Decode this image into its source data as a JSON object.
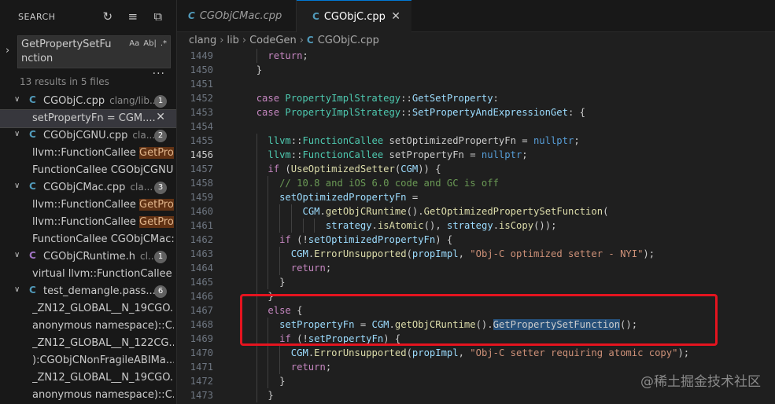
{
  "sidebar": {
    "title": "SEARCH",
    "search_value": "GetPropertySetFunction",
    "opt_case": "Aa",
    "opt_word": "Ab|",
    "opt_regex": ".*",
    "results": "13 results in 5 files",
    "more": "···",
    "files": [
      {
        "name": "CGObjC.cpp",
        "path": "clang/lib...",
        "count": "1",
        "kind": "cpp",
        "matches": [
          {
            "pre": "setPropertyFn = CGM....",
            "hl": "",
            "active": true
          }
        ]
      },
      {
        "name": "CGObjCGNU.cpp",
        "path": "cla...",
        "count": "2",
        "kind": "cpp",
        "matches": [
          {
            "pre": "llvm::FunctionCallee ",
            "hl": "GetPro..."
          },
          {
            "pre": "FunctionCallee CGObjCGNU...",
            "hl": ""
          }
        ]
      },
      {
        "name": "CGObjCMac.cpp",
        "path": "cla...",
        "count": "3",
        "kind": "cpp",
        "matches": [
          {
            "pre": "llvm::FunctionCallee ",
            "hl": "GetPro..."
          },
          {
            "pre": "llvm::FunctionCallee ",
            "hl": "GetPro..."
          },
          {
            "pre": "FunctionCallee CGObjCMac:...",
            "hl": ""
          }
        ]
      },
      {
        "name": "CGObjCRuntime.h",
        "path": "cl...",
        "count": "1",
        "kind": "h",
        "matches": [
          {
            "pre": "virtual llvm::FunctionCallee ",
            "hl": "..."
          }
        ]
      },
      {
        "name": "test_demangle.pass....",
        "path": "",
        "count": "6",
        "kind": "cpp",
        "matches": [
          {
            "pre": "_ZN12_GLOBAL__N_19CGO...",
            "hl": ""
          },
          {
            "pre": "anonymous namespace)::C...",
            "hl": ""
          },
          {
            "pre": "_ZN12_GLOBAL__N_122CG...",
            "hl": ""
          },
          {
            "pre": "):CGObjCNonFragileABIMa...",
            "hl": ""
          },
          {
            "pre": "_ZN12_GLOBAL__N_19CGO...",
            "hl": ""
          },
          {
            "pre": "anonymous namespace)::C...",
            "hl": ""
          }
        ]
      }
    ]
  },
  "tabs": [
    {
      "label": "CGObjCMac.cpp",
      "icon": "C"
    },
    {
      "label": "CGObjC.cpp",
      "icon": "C",
      "close": "✕"
    }
  ],
  "breadcrumb": [
    "clang",
    "lib",
    "CodeGen",
    "CGObjC.cpp"
  ],
  "editor": {
    "current_line": "1456",
    "lines": [
      {
        "n": "1449",
        "i": 2,
        "t": [
          [
            "kw",
            "return"
          ],
          [
            "",
            "; "
          ]
        ]
      },
      {
        "n": "1450",
        "i": 1,
        "t": [
          [
            "",
            "}"
          ]
        ]
      },
      {
        "n": "1451",
        "i": 0,
        "t": []
      },
      {
        "n": "1452",
        "i": 1,
        "t": [
          [
            "kw",
            "case "
          ],
          [
            "ty",
            "PropertyImplStrategy"
          ],
          [
            "",
            "::"
          ],
          [
            "vr",
            "GetSetProperty"
          ],
          [
            "",
            ":"
          ]
        ]
      },
      {
        "n": "1453",
        "i": 1,
        "t": [
          [
            "kw",
            "case "
          ],
          [
            "ty",
            "PropertyImplStrategy"
          ],
          [
            "",
            "::"
          ],
          [
            "vr",
            "SetPropertyAndExpressionGet"
          ],
          [
            "",
            ": {"
          ]
        ]
      },
      {
        "n": "1454",
        "i": 0,
        "t": []
      },
      {
        "n": "1455",
        "i": 2,
        "t": [
          [
            "ty",
            "llvm"
          ],
          [
            "",
            "::"
          ],
          [
            "ty",
            "FunctionCallee"
          ],
          [
            "",
            " setOptimizedPropertyFn = "
          ],
          [
            "kc",
            "nullptr"
          ],
          [
            "",
            ";"
          ]
        ]
      },
      {
        "n": "1456",
        "i": 2,
        "t": [
          [
            "ty",
            "llvm"
          ],
          [
            "",
            "::"
          ],
          [
            "ty",
            "FunctionCallee"
          ],
          [
            "",
            " setPropertyFn = "
          ],
          [
            "kc",
            "nullptr"
          ],
          [
            "",
            ";"
          ]
        ]
      },
      {
        "n": "1457",
        "i": 2,
        "t": [
          [
            "kw",
            "if"
          ],
          [
            "",
            " ("
          ],
          [
            "fn",
            "UseOptimizedSetter"
          ],
          [
            "",
            "("
          ],
          [
            "vr",
            "CGM"
          ],
          [
            "",
            ")) {"
          ]
        ]
      },
      {
        "n": "1458",
        "i": 3,
        "t": [
          [
            "cm",
            "// 10.8 and iOS 6.0 code and GC is off"
          ]
        ]
      },
      {
        "n": "1459",
        "i": 3,
        "t": [
          [
            "vr",
            "setOptimizedPropertyFn"
          ],
          [
            "",
            " ="
          ]
        ]
      },
      {
        "n": "1460",
        "i": 5,
        "t": [
          [
            "vr",
            "CGM"
          ],
          [
            "",
            "."
          ],
          [
            "fn",
            "getObjCRuntime"
          ],
          [
            "",
            "()."
          ],
          [
            "fn",
            "GetOptimizedPropertySetFunction"
          ],
          [
            "",
            "("
          ]
        ]
      },
      {
        "n": "1461",
        "i": 7,
        "t": [
          [
            "vr",
            "strategy"
          ],
          [
            "",
            "."
          ],
          [
            "fn",
            "isAtomic"
          ],
          [
            "",
            "(), "
          ],
          [
            "vr",
            "strategy"
          ],
          [
            "",
            "."
          ],
          [
            "fn",
            "isCopy"
          ],
          [
            "",
            "());"
          ]
        ]
      },
      {
        "n": "1462",
        "i": 3,
        "t": [
          [
            "kw",
            "if"
          ],
          [
            "",
            " (!"
          ],
          [
            "vr",
            "setOptimizedPropertyFn"
          ],
          [
            "",
            ") {"
          ]
        ]
      },
      {
        "n": "1463",
        "i": 4,
        "t": [
          [
            "vr",
            "CGM"
          ],
          [
            "",
            "."
          ],
          [
            "fn",
            "ErrorUnsupported"
          ],
          [
            "",
            "("
          ],
          [
            "vr",
            "propImpl"
          ],
          [
            "",
            ", "
          ],
          [
            "st",
            "\"Obj-C optimized setter - NYI\""
          ],
          [
            "",
            ");"
          ]
        ]
      },
      {
        "n": "1464",
        "i": 4,
        "t": [
          [
            "kw",
            "return"
          ],
          [
            "",
            ";"
          ]
        ]
      },
      {
        "n": "1465",
        "i": 3,
        "t": [
          [
            "",
            "}"
          ]
        ]
      },
      {
        "n": "1466",
        "i": 2,
        "t": [
          [
            "",
            "}"
          ]
        ]
      },
      {
        "n": "1467",
        "i": 2,
        "t": [
          [
            "kw",
            "else"
          ],
          [
            "",
            " {"
          ]
        ]
      },
      {
        "n": "1468",
        "i": 3,
        "t": [
          [
            "vr",
            "setPropertyFn"
          ],
          [
            "",
            " = "
          ],
          [
            "vr",
            "CGM"
          ],
          [
            "",
            "."
          ],
          [
            "fn",
            "getObjCRuntime"
          ],
          [
            "",
            "()."
          ],
          [
            "sel",
            "GetPropertySetFunction"
          ],
          [
            "",
            "();"
          ]
        ]
      },
      {
        "n": "1469",
        "i": 3,
        "t": [
          [
            "kw",
            "if"
          ],
          [
            "",
            " (!"
          ],
          [
            "vr",
            "setPropertyFn"
          ],
          [
            "",
            ") {"
          ]
        ]
      },
      {
        "n": "1470",
        "i": 4,
        "t": [
          [
            "vr",
            "CGM"
          ],
          [
            "",
            "."
          ],
          [
            "fn",
            "ErrorUnsupported"
          ],
          [
            "",
            "("
          ],
          [
            "vr",
            "propImpl"
          ],
          [
            "",
            ", "
          ],
          [
            "st",
            "\"Obj-C setter requiring atomic copy\""
          ],
          [
            "",
            ");"
          ]
        ]
      },
      {
        "n": "1471",
        "i": 4,
        "t": [
          [
            "kw",
            "return"
          ],
          [
            "",
            ";"
          ]
        ]
      },
      {
        "n": "1472",
        "i": 3,
        "t": [
          [
            "",
            "}"
          ]
        ]
      },
      {
        "n": "1473",
        "i": 2,
        "t": [
          [
            "",
            "}"
          ]
        ]
      }
    ]
  },
  "watermark": "@稀土掘金技术社区"
}
